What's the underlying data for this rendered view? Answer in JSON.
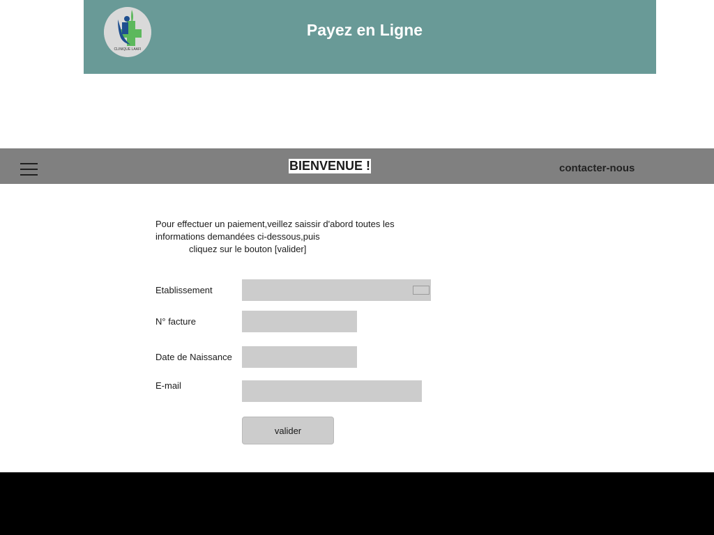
{
  "header": {
    "title": "Payez en Ligne",
    "logo_text": "CLINIQUE LAAFI",
    "background": "#699a97"
  },
  "navbar": {
    "menu_icon": "hamburger-menu-icon",
    "welcome": "BIENVENUE !",
    "contact": "contacter-nous",
    "background": "#808080"
  },
  "intro": {
    "line1": "Pour effectuer un paiement,veillez saissir d'abord toutes les informations demandées ci-dessous,puis",
    "line2": "cliquez sur le bouton [valider]"
  },
  "form": {
    "etablissement_label": "Etablissement",
    "etablissement_value": "",
    "facture_label": "N° facture",
    "facture_value": "",
    "naissance_label": "Date de Naissance",
    "naissance_value": "",
    "email_label": "E-mail",
    "email_value": "",
    "submit_label": "valider"
  },
  "footer": {
    "background": "#000000"
  }
}
